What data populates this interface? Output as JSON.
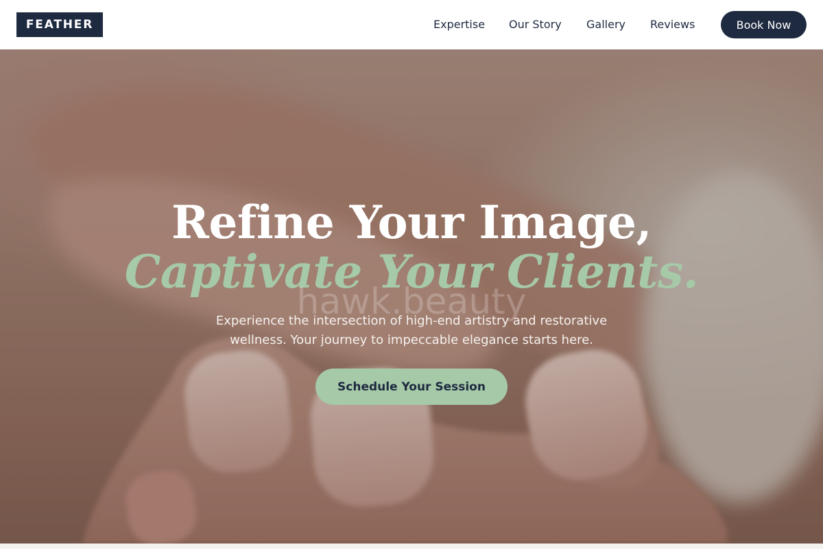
{
  "header": {
    "logo": "FEATHER",
    "nav": {
      "expertise": "Expertise",
      "story": "Our Story",
      "gallery": "Gallery",
      "reviews": "Reviews"
    },
    "book_label": "Book Now"
  },
  "hero": {
    "headline_line1": "Refine Your Image,",
    "headline_line2": "Captivate Your Clients.",
    "watermark": "hawk.beauty",
    "subtitle": "Experience the intersection of high-end artistry and restorative wellness. Your journey to impeccable elegance starts here.",
    "cta_label": "Schedule Your Session",
    "image_subject": "hand-with-nude-manicure-photo"
  },
  "colors": {
    "navy": "#1e2a40",
    "sage": "#a6c9a8",
    "white": "#ffffff"
  }
}
